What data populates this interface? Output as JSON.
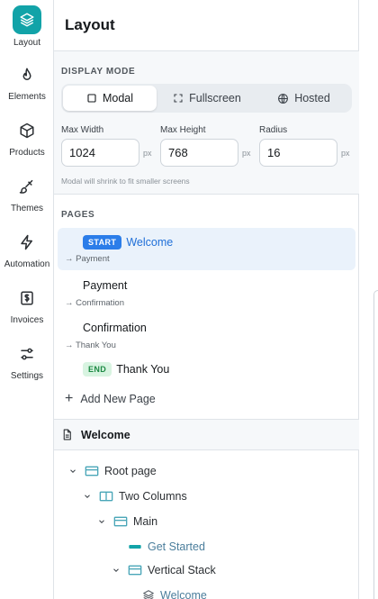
{
  "rail": {
    "items": [
      {
        "label": "Layout",
        "icon": "layers-icon",
        "active": true
      },
      {
        "label": "Elements",
        "icon": "flame-icon"
      },
      {
        "label": "Products",
        "icon": "box-icon"
      },
      {
        "label": "Themes",
        "icon": "brush-icon"
      },
      {
        "label": "Automation",
        "icon": "lightning-icon"
      },
      {
        "label": "Invoices",
        "icon": "invoice-icon"
      },
      {
        "label": "Settings",
        "icon": "sliders-icon"
      }
    ],
    "accent": "#12a3a8"
  },
  "panel": {
    "title": "Layout",
    "display_mode": {
      "label": "DISPLAY MODE",
      "options": [
        {
          "label": "Modal",
          "icon": "square-icon",
          "selected": true
        },
        {
          "label": "Fullscreen",
          "icon": "expand-icon"
        },
        {
          "label": "Hosted",
          "icon": "globe-icon"
        }
      ]
    },
    "fields": {
      "max_width": {
        "label": "Max Width",
        "value": "1024",
        "unit": "px"
      },
      "max_height": {
        "label": "Max Height",
        "value": "768",
        "unit": "px"
      },
      "radius": {
        "label": "Radius",
        "value": "16",
        "unit": "px"
      }
    },
    "hint": "Modal will shrink to fit smaller screens",
    "pages": {
      "label": "PAGES",
      "items": [
        {
          "badge": "START",
          "name": "Welcome",
          "next": "→ Payment",
          "selected": true
        },
        {
          "badge": "",
          "name": "Payment",
          "next": "→ Confirmation"
        },
        {
          "badge": "",
          "name": "Confirmation",
          "next": "→ Thank You"
        },
        {
          "badge": "END",
          "name": "Thank You",
          "next": ""
        }
      ],
      "add_label": "Add New Page"
    },
    "current_page": "Welcome",
    "tree": [
      {
        "label": "Root page"
      },
      {
        "label": "Two Columns"
      },
      {
        "label": "Main"
      },
      {
        "label": "Get Started"
      },
      {
        "label": "Vertical Stack"
      },
      {
        "label": "Welcome"
      }
    ]
  },
  "colors": {
    "start_badge": "#2b7de9",
    "end_badge_bg": "#d8f4e1",
    "selected_row": "#eaf2fb"
  }
}
